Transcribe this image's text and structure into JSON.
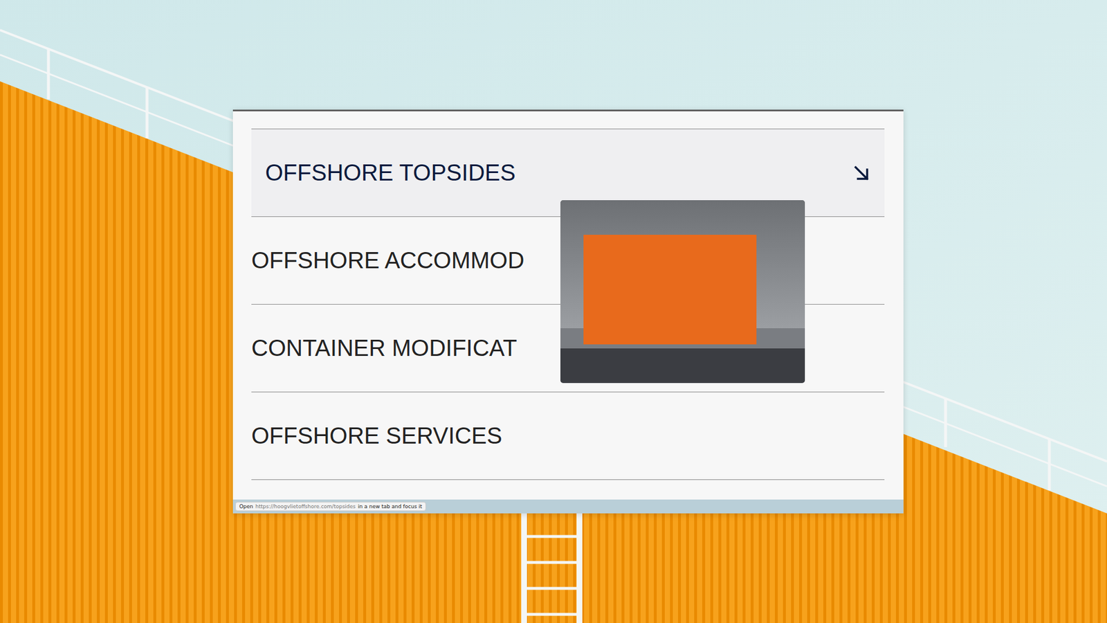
{
  "rows": [
    {
      "label": "OFFSHORE TOPSIDES",
      "selected": true
    },
    {
      "label": "OFFSHORE ACCOMMOD",
      "selected": false
    },
    {
      "label": "CONTAINER MODIFICAT",
      "selected": false
    },
    {
      "label": "OFFSHORE SERVICES",
      "selected": false
    }
  ],
  "status_bar": {
    "prefix": "Open",
    "url": "https://hoogvlietoffshore.com/topsides",
    "suffix": "in a new tab and focus it"
  }
}
